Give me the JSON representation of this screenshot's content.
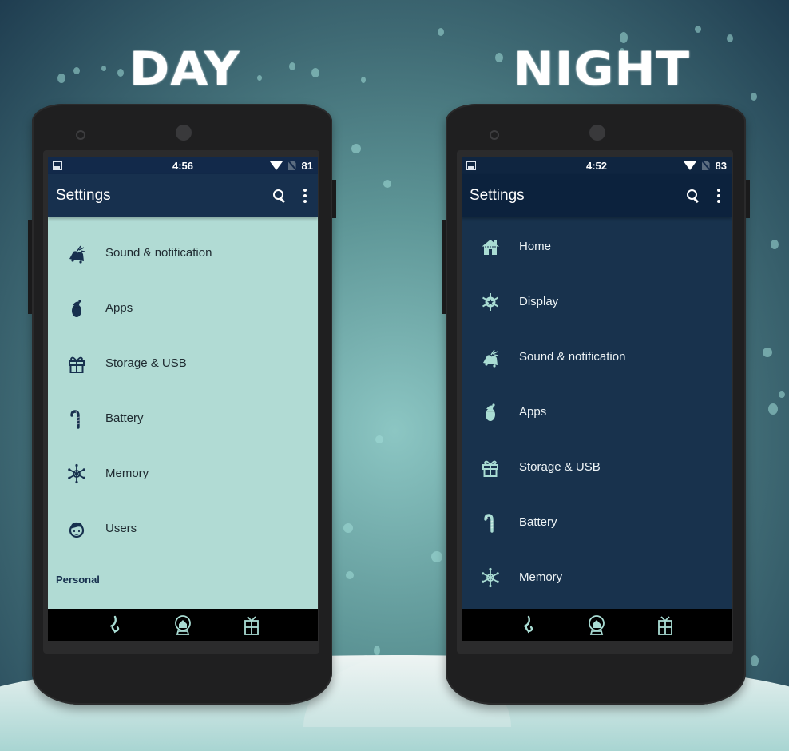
{
  "headings": {
    "day": "DAY",
    "night": "NIGHT"
  },
  "colors": {
    "day_content_bg": "#b1dbd4",
    "night_content_bg": "#18324d",
    "appbar_bg": "#17304e",
    "icon_day": "#17304e",
    "icon_night": "#a9dcd3",
    "nav_icon": "#a9dcd3"
  },
  "day_phone": {
    "status_bar": {
      "time": "4:56",
      "battery": "81",
      "icons": [
        "image-icon",
        "wifi-icon",
        "no-sim-icon"
      ]
    },
    "app_bar": {
      "title": "Settings",
      "actions": [
        "search-icon",
        "more-vert-icon"
      ]
    },
    "items": [
      {
        "label": "Sound & notification",
        "icon": "bells-icon"
      },
      {
        "label": "Apps",
        "icon": "ornament-icon"
      },
      {
        "label": "Storage & USB",
        "icon": "gift-icon"
      },
      {
        "label": "Battery",
        "icon": "candy-cane-icon"
      },
      {
        "label": "Memory",
        "icon": "snowflake-icon"
      },
      {
        "label": "Users",
        "icon": "elf-face-icon"
      }
    ],
    "section_header": "Personal",
    "nav_bar": [
      "back-stocking-icon",
      "home-snowglobe-icon",
      "recents-gift-icon"
    ]
  },
  "night_phone": {
    "status_bar": {
      "time": "4:52",
      "battery": "83",
      "icons": [
        "image-icon",
        "wifi-icon",
        "no-sim-icon"
      ]
    },
    "app_bar": {
      "title": "Settings",
      "actions": [
        "search-icon",
        "more-vert-icon"
      ]
    },
    "items": [
      {
        "label": "Home",
        "icon": "house-icon"
      },
      {
        "label": "Display",
        "icon": "snowflake-star-icon"
      },
      {
        "label": "Sound & notification",
        "icon": "bells-icon"
      },
      {
        "label": "Apps",
        "icon": "ornament-icon"
      },
      {
        "label": "Storage & USB",
        "icon": "gift-icon"
      },
      {
        "label": "Battery",
        "icon": "candy-cane-icon"
      },
      {
        "label": "Memory",
        "icon": "snowflake-icon"
      }
    ],
    "nav_bar": [
      "back-stocking-icon",
      "home-snowglobe-icon",
      "recents-gift-icon"
    ]
  }
}
